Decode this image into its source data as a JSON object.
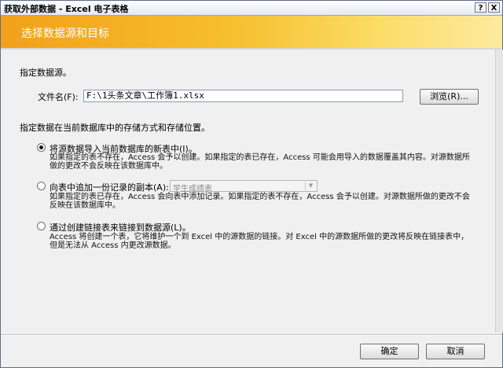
{
  "window": {
    "title": "获取外部数据 - Excel 电子表格",
    "help_label": "?",
    "close_label": "X"
  },
  "header": {
    "title": "选择数据源和目标"
  },
  "source": {
    "prompt": "指定数据源。",
    "file_label": "文件名(F):",
    "file_value": "F:\\1头条文章\\工作簿1.xlsx",
    "browse_label": "浏览(R)..."
  },
  "storage": {
    "prompt": "指定数据在当前数据库中的存储方式和存储位置。"
  },
  "options": [
    {
      "label": "将源数据导入当前数据库的新表中(I)。",
      "selected": true,
      "desc1": "如果指定的表不存在，Access 会予以创建。如果指定的表已存在，Access 可能会用导入的数据覆盖其内容。对源数据所",
      "desc2": "做的更改不会反映在该数据库中。"
    },
    {
      "label": "向表中追加一份记录的副本(A):",
      "selected": false,
      "select_value": "学生成绩表",
      "desc1": "如果指定的表已存在，Access 会向表中添加记录。如果指定的表不存在，Access 会予以创建。对源数据所做的更改不会",
      "desc2": "反映在该数据库中。"
    },
    {
      "label": "通过创建链接表来链接到数据源(L)。",
      "selected": false,
      "desc1": "Access 将创建一个表，它将维护一个到 Excel 中的源数据的链接。对 Excel 中的源数据所做的更改将反映在链接表中，",
      "desc2": "但是无法从 Access 内更改源数据。"
    }
  ],
  "footer": {
    "ok_label": "确定",
    "cancel_label": "取消"
  }
}
